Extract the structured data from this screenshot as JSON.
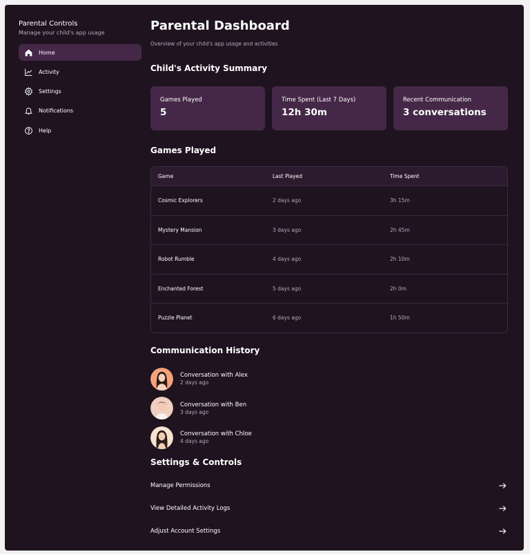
{
  "sidebar": {
    "title": "Parental Controls",
    "subtitle": "Manage your child's app usage",
    "items": [
      {
        "label": "Home",
        "icon": "home-icon",
        "active": true
      },
      {
        "label": "Activity",
        "icon": "activity-chart-icon",
        "active": false
      },
      {
        "label": "Settings",
        "icon": "gear-icon",
        "active": false
      },
      {
        "label": "Notifications",
        "icon": "bell-icon",
        "active": false
      },
      {
        "label": "Help",
        "icon": "help-circle-icon",
        "active": false
      }
    ]
  },
  "header": {
    "title": "Parental Dashboard",
    "subtitle": "Overview of your child's app usage and activities"
  },
  "summary": {
    "title": "Child's Activity Summary",
    "cards": [
      {
        "label": "Games Played",
        "value": "5"
      },
      {
        "label": "Time Spent (Last 7 Days)",
        "value": "12h 30m"
      },
      {
        "label": "Recent Communication",
        "value": "3 conversations"
      }
    ]
  },
  "games": {
    "title": "Games Played",
    "columns": [
      "Game",
      "Last Played",
      "Time Spent"
    ],
    "rows": [
      [
        "Cosmic Explorers",
        "2 days ago",
        "3h 15m"
      ],
      [
        "Mystery Mansion",
        "3 days ago",
        "2h 45m"
      ],
      [
        "Robot Rumble",
        "4 days ago",
        "2h 10m"
      ],
      [
        "Enchanted Forest",
        "5 days ago",
        "2h 0m"
      ],
      [
        "Puzzle Planet",
        "6 days ago",
        "1h 50m"
      ]
    ]
  },
  "communication": {
    "title": "Communication History",
    "items": [
      {
        "title": "Conversation with Alex",
        "time": "2 days ago"
      },
      {
        "title": "Conversation with Ben",
        "time": "3 days ago"
      },
      {
        "title": "Conversation with Chloe",
        "time": "4 days ago"
      }
    ]
  },
  "settings": {
    "title": "Settings & Controls",
    "items": [
      {
        "label": "Manage Permissions"
      },
      {
        "label": "View Detailed Activity Logs"
      },
      {
        "label": "Adjust Account Settings"
      }
    ]
  },
  "colors": {
    "background": "#1f1320",
    "card": "#452747",
    "accent_active": "#452747",
    "muted_text": "#b9a8bb"
  }
}
